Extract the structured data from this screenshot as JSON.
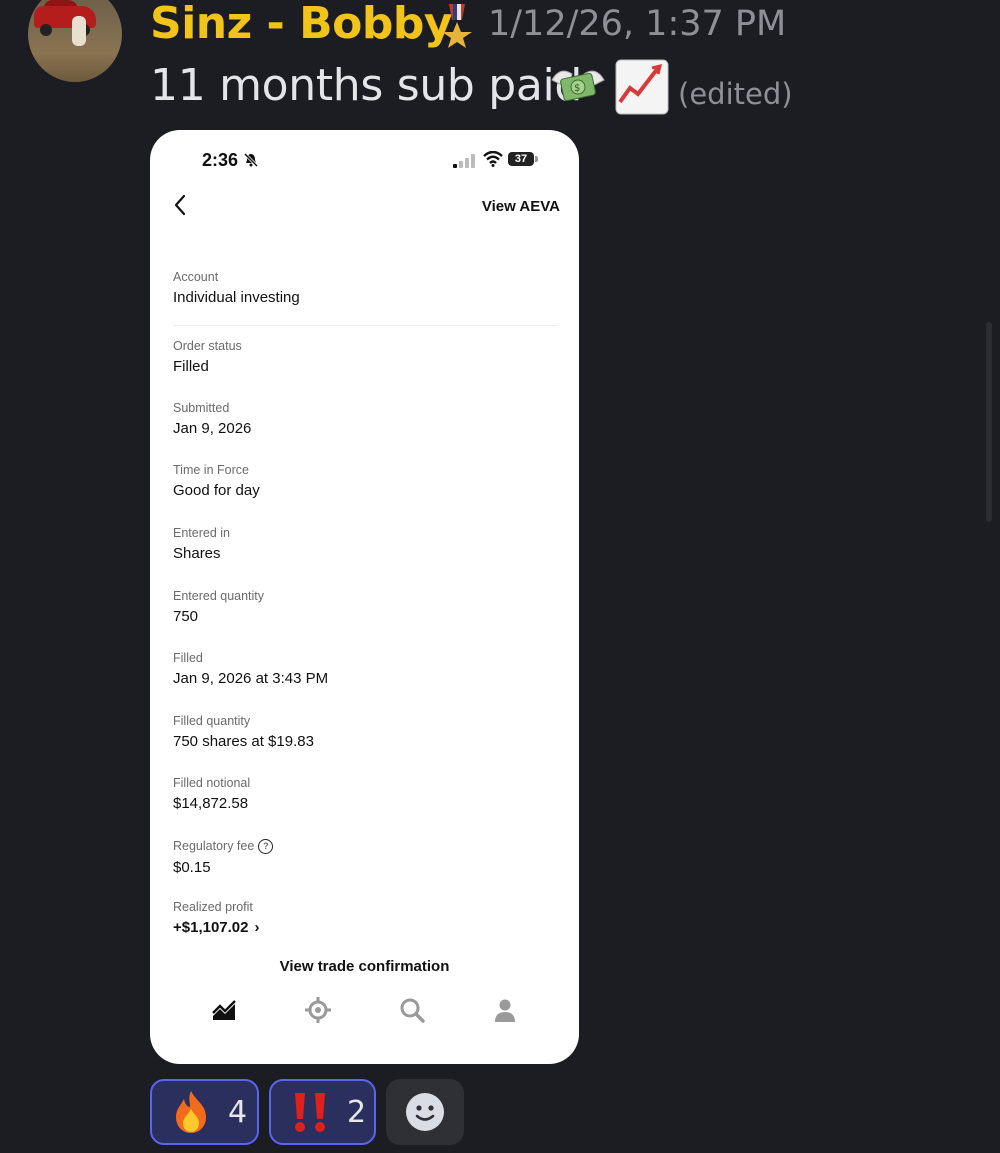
{
  "message": {
    "author": "Sinz - Bobby",
    "timestamp": "1/12/26, 1:37 PM",
    "text": "11 months sub paid",
    "edited_label": "(edited)",
    "author_color": "#f2c318",
    "badge_icon": "military-medal-icon",
    "emojis": [
      "money-with-wings-emoji",
      "chart-increasing-emoji"
    ]
  },
  "phone": {
    "status_time": "2:36",
    "battery": "37",
    "header_action": "View AEVA",
    "fields": [
      {
        "label": "Account",
        "value": "Individual investing"
      },
      {
        "label": "Order status",
        "value": "Filled"
      },
      {
        "label": "Submitted",
        "value": "Jan 9, 2026"
      },
      {
        "label": "Time in Force",
        "value": "Good for day"
      },
      {
        "label": "Entered in",
        "value": "Shares"
      },
      {
        "label": "Entered quantity",
        "value": "750"
      },
      {
        "label": "Filled",
        "value": "Jan 9, 2026 at 3:43 PM"
      },
      {
        "label": "Filled quantity",
        "value": "750 shares at $19.83"
      },
      {
        "label": "Filled notional",
        "value": "$14,872.58"
      },
      {
        "label": "Regulatory fee",
        "value": "$0.15"
      },
      {
        "label": "Realized profit",
        "value": "+$1,107.02"
      }
    ],
    "footer_button": "View trade confirmation",
    "tabs": [
      "investing-chart-icon",
      "crypto-icon",
      "search-icon",
      "account-icon"
    ]
  },
  "reactions": [
    {
      "emoji": "fire-emoji",
      "count": "4"
    },
    {
      "emoji": "double-exclamation-emoji",
      "count": "2"
    }
  ],
  "add_reaction_icon": "smiley-icon"
}
